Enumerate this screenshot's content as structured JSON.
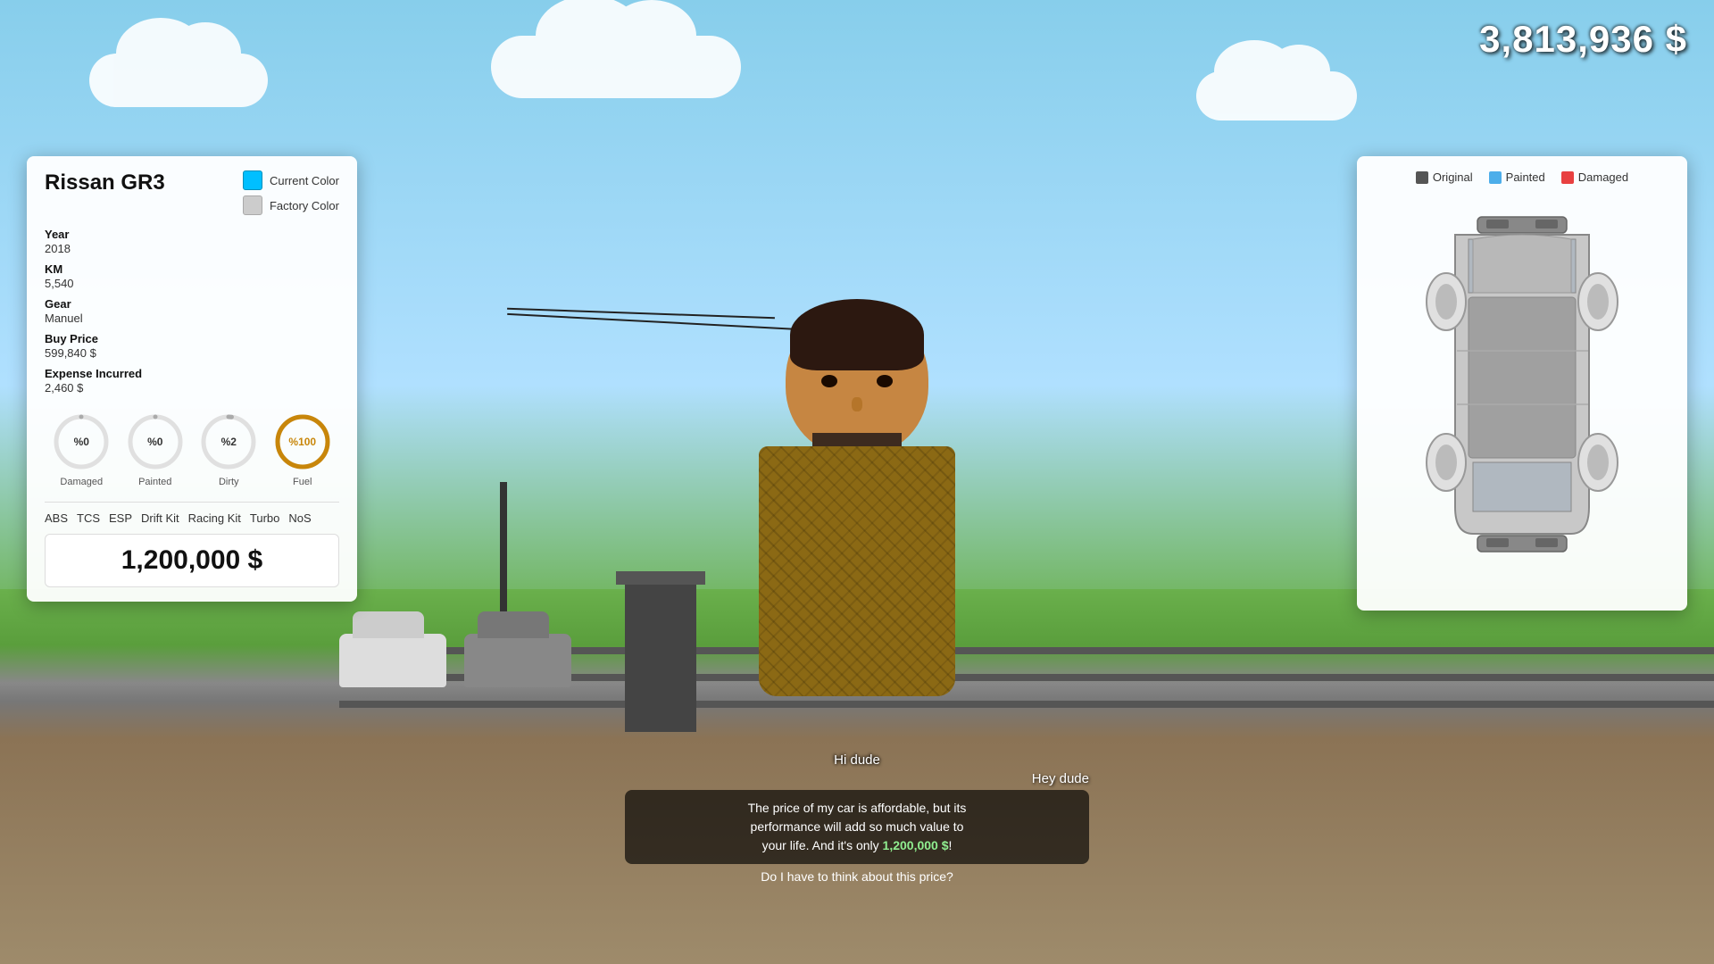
{
  "hud": {
    "money": "3,813,936 $"
  },
  "car_info": {
    "name": "Rissan GR3",
    "current_color_label": "Current Color",
    "factory_color_label": "Factory Color",
    "current_color_hex": "#00BFFF",
    "factory_color_hex": "#CCCCCC",
    "year_label": "Year",
    "year_value": "2018",
    "km_label": "KM",
    "km_value": "5,540",
    "gear_label": "Gear",
    "gear_value": "Manuel",
    "buy_price_label": "Buy Price",
    "buy_price_value": "599,840 $",
    "expense_label": "Expense Incurred",
    "expense_value": "2,460 $",
    "gauges": [
      {
        "id": "damaged",
        "label": "Damaged",
        "value": 0,
        "display": "%0",
        "color": "#aaa",
        "percent": 0
      },
      {
        "id": "painted",
        "label": "Painted",
        "value": 0,
        "display": "%0",
        "color": "#aaa",
        "percent": 0
      },
      {
        "id": "dirty",
        "label": "Dirty",
        "value": 2,
        "display": "%2",
        "color": "#aaa",
        "percent": 2
      },
      {
        "id": "fuel",
        "label": "Fuel",
        "value": 100,
        "display": "%100",
        "color": "#C8860A",
        "percent": 100
      }
    ],
    "features": [
      "ABS",
      "TCS",
      "ESP",
      "Drift Kit",
      "Racing Kit",
      "Turbo",
      "NoS"
    ],
    "sell_price": "1,200,000 $"
  },
  "diagram": {
    "legend": [
      {
        "label": "Original",
        "color": "#555555"
      },
      {
        "label": "Painted",
        "color": "#4DAEEA"
      },
      {
        "label": "Damaged",
        "color": "#E84040"
      }
    ]
  },
  "dialogue": {
    "player_line": "Hi dude",
    "npc_label": "Hey dude",
    "npc_speech": "The price of my car is affordable, but its\nperformance will add so much value to\nyour life. And it's only 1,200,000 $!",
    "price_highlight": "1,200,000 $",
    "question": "Do I have to think about this price?"
  }
}
